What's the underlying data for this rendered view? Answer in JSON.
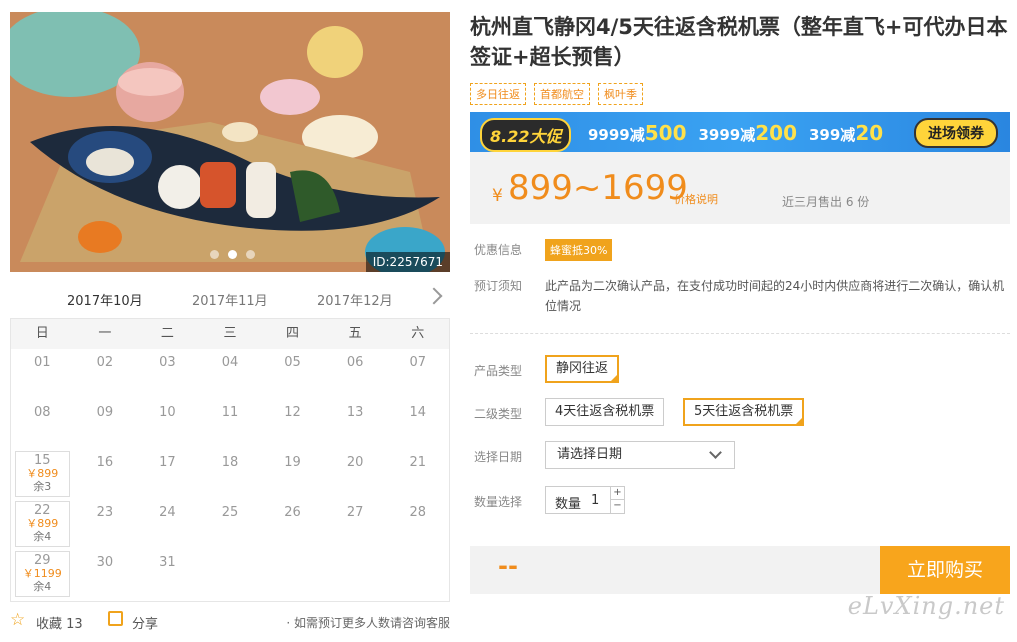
{
  "gallery": {
    "image_id": "ID:2257671",
    "slide_count": 3,
    "active_slide": 2
  },
  "calendar": {
    "months": [
      "2017年10月",
      "2017年11月",
      "2017年12月"
    ],
    "weekdays": [
      "日",
      "一",
      "二",
      "三",
      "四",
      "五",
      "六"
    ],
    "days": [
      {
        "d": "01"
      },
      {
        "d": "02"
      },
      {
        "d": "03"
      },
      {
        "d": "04"
      },
      {
        "d": "05"
      },
      {
        "d": "06"
      },
      {
        "d": "07"
      },
      {
        "d": "08"
      },
      {
        "d": "09"
      },
      {
        "d": "10"
      },
      {
        "d": "11"
      },
      {
        "d": "12"
      },
      {
        "d": "13"
      },
      {
        "d": "14"
      },
      {
        "d": "15",
        "price": "￥899",
        "stock": "余3"
      },
      {
        "d": "16"
      },
      {
        "d": "17"
      },
      {
        "d": "18"
      },
      {
        "d": "19"
      },
      {
        "d": "20"
      },
      {
        "d": "21"
      },
      {
        "d": "22",
        "price": "￥899",
        "stock": "余4"
      },
      {
        "d": "23"
      },
      {
        "d": "24"
      },
      {
        "d": "25"
      },
      {
        "d": "26"
      },
      {
        "d": "27"
      },
      {
        "d": "28"
      },
      {
        "d": "29",
        "price": "￥1199",
        "stock": "余4"
      },
      {
        "d": "30"
      },
      {
        "d": "31"
      }
    ]
  },
  "footer": {
    "favorite": "收藏 13",
    "share": "分享",
    "consult": "· 如需预订更多人数请咨询客服"
  },
  "product": {
    "title": "杭州直飞静冈4/5天往返含税机票（整年直飞+可代办日本签证+超长预售）",
    "tags": [
      "多日往返",
      "首都航空",
      "枫叶季"
    ]
  },
  "banner": {
    "badge": "8.22大促",
    "offers": [
      {
        "pre": "9999减",
        "amt": "500"
      },
      {
        "pre": "3999减",
        "amt": "200"
      },
      {
        "pre": "399减",
        "amt": "20"
      }
    ],
    "cta": "进场领券",
    "colors": {
      "bg": "#2f8fe6",
      "accent": "#ffd43a"
    }
  },
  "price": {
    "yen": "¥",
    "range": "899~1699",
    "note": "价格说明",
    "sold": "近三月售出 6 份"
  },
  "info": {
    "promo_label": "优惠信息",
    "promo": "蜂蜜抵30%",
    "notice_label": "预订须知",
    "notice": "此产品为二次确认产品，在支付成功时间起的24小时内供应商将进行二次确认，确认机位情况"
  },
  "options": {
    "type_label": "产品类型",
    "type_value": "静冈往返",
    "sub_label": "二级类型",
    "sub_values": [
      "4天往返含税机票",
      "5天往返含税机票"
    ],
    "date_label": "选择日期",
    "date_placeholder": "请选择日期",
    "qty_label": "数量选择",
    "qty_inner": "数量",
    "qty_value": "1",
    "plus": "+",
    "minus": "−"
  },
  "buy": {
    "total": "--",
    "button": "立即购买",
    "accent": "#f8a51c"
  },
  "watermark": "eLvXing.net"
}
